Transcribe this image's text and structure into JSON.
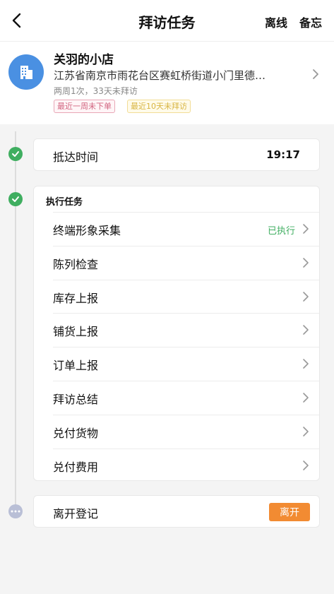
{
  "header": {
    "title": "拜访任务",
    "offline_label": "离线",
    "memo_label": "备忘"
  },
  "store": {
    "name": "关羽的小店",
    "address": "江苏省南京市雨花台区赛虹桥街道小门里德…",
    "visit_info": "两周1次，33天未拜访",
    "tags": [
      "最近一周未下单",
      "最近10天未拜访"
    ]
  },
  "arrival": {
    "label": "抵达时间",
    "time": "19:17"
  },
  "tasks": {
    "title": "执行任务",
    "items": [
      {
        "label": "终端形象采集",
        "status": "已执行"
      },
      {
        "label": "陈列检查",
        "status": ""
      },
      {
        "label": "库存上报",
        "status": ""
      },
      {
        "label": "铺货上报",
        "status": ""
      },
      {
        "label": "订单上报",
        "status": ""
      },
      {
        "label": "拜访总结",
        "status": ""
      },
      {
        "label": "兑付货物",
        "status": ""
      },
      {
        "label": "兑付费用",
        "status": ""
      }
    ]
  },
  "leave": {
    "label": "离开登记",
    "button_label": "离开"
  },
  "colors": {
    "accent_green": "#3fae60",
    "leave_orange": "#f28b32",
    "avatar_blue": "#4a90e2"
  },
  "icons": [
    "back-arrow-icon",
    "store-building-icon",
    "chevron-right-icon",
    "check-icon",
    "more-dots-icon"
  ]
}
